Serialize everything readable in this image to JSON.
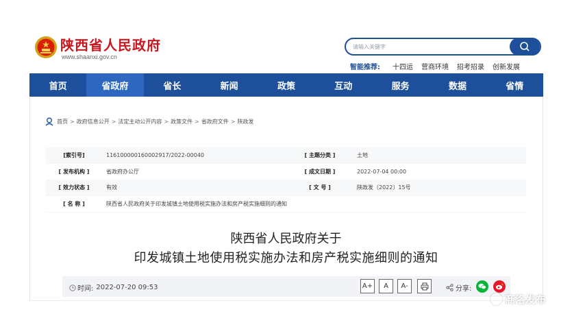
{
  "header": {
    "site_name": "陕西省人民政府",
    "site_url": "www.shaanxi.gov.cn",
    "search_placeholder": "请输入关键字",
    "smart_rec_label": "智能推荐:",
    "smart_rec_links": [
      "十四运",
      "营商环境",
      "招考招录",
      "创新发展"
    ]
  },
  "nav": {
    "items": [
      "首页",
      "省政府",
      "省长",
      "新闻",
      "政策",
      "互动",
      "服务",
      "数据",
      "省情"
    ],
    "active_index": 1
  },
  "breadcrumb": [
    "首页",
    "政府信息公开",
    "法定主动公开内容",
    "政策文件",
    "省政府文件",
    "陕政发"
  ],
  "meta": {
    "index_no_key": "[索引号]",
    "index_no_val": "116100000160002917/2022-00040",
    "topic_key": "[ 主题分类 ]",
    "topic_val": "土地",
    "issuer_key": "[ 发布机构 ]",
    "issuer_val": "省政府办公厅",
    "date_key": "[ 成文日期 ]",
    "date_val": "2022-07-04 00:00",
    "status_key": "[ 效力状态 ]",
    "status_val": "有效",
    "docno_key": "[ 文 号 ]",
    "docno_val": "陕政发〔2022〕15号",
    "name_key": "[ 名 称 ]",
    "name_val": "陕西省人民政府关于印发城镇土地使用税实施办法和房产税实施细则的通知"
  },
  "article": {
    "title_line1": "陕西省人民政府关于",
    "title_line2": "印发城镇土地使用税实施办法和房产税实施细则的通知",
    "time_label": "时间:",
    "time_value": "2022-07-20 09:53",
    "font_buttons": [
      "A+",
      "A",
      "A-"
    ],
    "share_label": "分享:"
  },
  "watermark": "商洛发布",
  "colors": {
    "brand_red": "#c8171e",
    "nav_blue": "#1e4f9a",
    "nav_active": "#2d67c0",
    "wechat_green": "#07b53b",
    "weibo_red": "#e6162d"
  },
  "icons": [
    "national-emblem-icon",
    "search-icon",
    "location-pin-icon",
    "clock-icon",
    "print-icon",
    "share-icon",
    "wechat-icon",
    "weibo-icon"
  ]
}
